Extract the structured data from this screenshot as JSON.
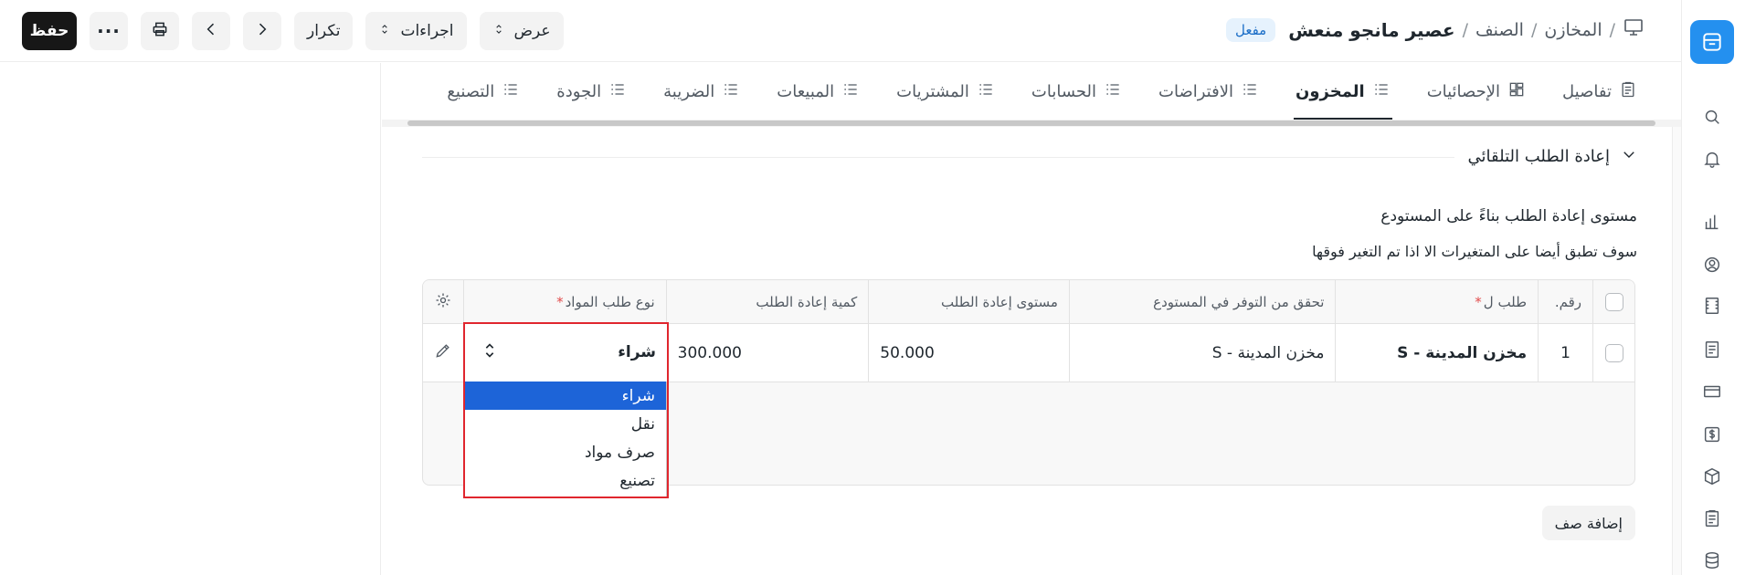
{
  "breadcrumb": {
    "items": [
      "المخازن",
      "الصنف"
    ],
    "title": "عصير مانجو منعش",
    "status": "مفعل"
  },
  "toolbar": {
    "view_label": "عرض",
    "actions_label": "اجراءات",
    "duplicate_label": "تكرار",
    "save_label": "حفظ"
  },
  "tabs": [
    {
      "label": "تفاصيل",
      "icon": "details-icon"
    },
    {
      "label": "الإحصائيات",
      "icon": "dashboard-icon"
    },
    {
      "label": "المخزون",
      "icon": "list-icon",
      "active": true
    },
    {
      "label": "الافتراضات",
      "icon": "list-icon"
    },
    {
      "label": "الحسابات",
      "icon": "list-icon"
    },
    {
      "label": "المشتريات",
      "icon": "list-icon"
    },
    {
      "label": "المبيعات",
      "icon": "list-icon"
    },
    {
      "label": "الضريبة",
      "icon": "list-icon"
    },
    {
      "label": "الجودة",
      "icon": "list-icon"
    },
    {
      "label": "التصنيع",
      "icon": "list-icon"
    }
  ],
  "section": {
    "title": "إعادة الطلب التلقائي",
    "field_label": "مستوى إعادة الطلب بناءً على المستودع",
    "field_description": "سوف تطبق أيضا على المتغيرات الا اذا تم التغير فوقها"
  },
  "table": {
    "headers": {
      "no": "رقم.",
      "warehouse": "طلب ل",
      "check_in": "تحقق من التوفر في المستودع",
      "level": "مستوى إعادة الطلب",
      "qty": "كمية إعادة الطلب",
      "type": "نوع طلب المواد"
    },
    "rows": [
      {
        "no": "1",
        "warehouse": "مخزن المدينة - S",
        "check_in": "مخزن المدينة - S",
        "level": "50.000",
        "qty": "300.000",
        "type": "شراء"
      }
    ],
    "add_row_label": "إضافة صف"
  },
  "dropdown": {
    "options": [
      "شراء",
      "نقل",
      "صرف مواد",
      "تصنيع"
    ],
    "selected": "شراء"
  },
  "colors": {
    "accent": "#2490ef",
    "selection": "#1d64d8",
    "focus": "#e0262e",
    "primary_button": "#171717"
  }
}
